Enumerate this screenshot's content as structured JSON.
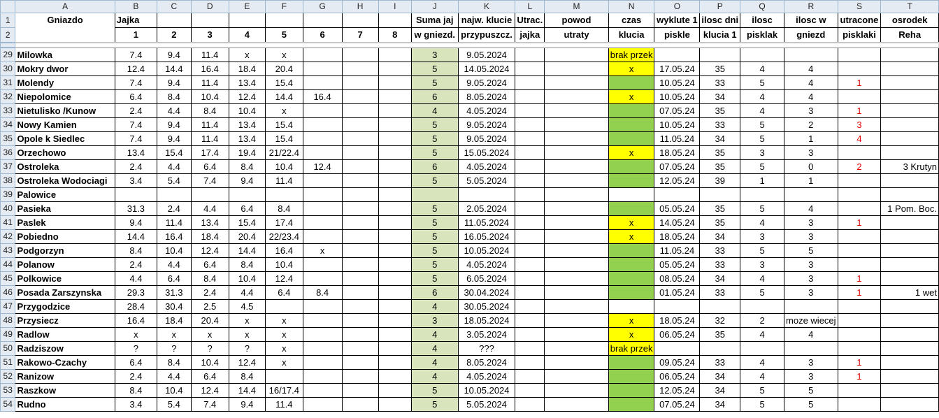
{
  "columns": [
    "A",
    "B",
    "C",
    "D",
    "E",
    "F",
    "G",
    "H",
    "I",
    "J",
    "K",
    "L",
    "M",
    "N",
    "O",
    "P",
    "Q",
    "R",
    "S",
    "T"
  ],
  "header": {
    "row1": {
      "num": "1",
      "A": "Gniazdo",
      "B": "Jajka",
      "J": "Suma jaj",
      "K": "najw. klucie",
      "L": "Utrac.",
      "M": "powod",
      "N": "czas",
      "O": "wyklute 1",
      "P": "ilosc dni",
      "Q": "ilosc",
      "R": "ilosc w",
      "S": "utracone",
      "T": "osrodek"
    },
    "row2": {
      "num": "2",
      "B": "1",
      "C": "2",
      "D": "3",
      "E": "4",
      "F": "5",
      "G": "6",
      "H": "7",
      "I": "8",
      "J": "w gniezd.",
      "K": "przypuszcz.",
      "L": "jajka",
      "M": "utraty",
      "N": "klucia",
      "O": "piskle",
      "P": "klucia 1",
      "Q": "pisklak",
      "R": "gniezd",
      "S": "pisklaki",
      "T": "Reha"
    }
  },
  "rows": [
    {
      "num": "29",
      "name": "Milowka",
      "eggs": [
        "7.4",
        "9.4",
        "11.4",
        "x",
        "x",
        "",
        "",
        ""
      ],
      "total": "3",
      "date": "9.05.2024",
      "lost": "",
      "reason": "",
      "time": "brak przek",
      "hatched": "",
      "days": "",
      "chicks": "",
      "innest": "",
      "lostchicks": "",
      "center": ""
    },
    {
      "num": "30",
      "name": "Mokry dwor",
      "eggs": [
        "12.4",
        "14.4",
        "16.4",
        "18.4",
        "20.4",
        "",
        "",
        ""
      ],
      "total": "5",
      "date": "14.05.2024",
      "lost": "",
      "reason": "",
      "time": "x",
      "hatched": "17.05.24",
      "days": "35",
      "chicks": "4",
      "innest": "4",
      "lostchicks": "",
      "center": ""
    },
    {
      "num": "31",
      "name": "Molendy",
      "eggs": [
        "7.4",
        "9.4",
        "11.4",
        "13.4",
        "15.4",
        "",
        "",
        ""
      ],
      "total": "5",
      "date": "9.05.2024",
      "lost": "",
      "reason": "",
      "time": "",
      "hatched": "10.05.24",
      "days": "33",
      "chicks": "5",
      "innest": "4",
      "lostchicks": "1",
      "center": ""
    },
    {
      "num": "32",
      "name": "Niepolomice",
      "eggs": [
        "6.4",
        "8.4",
        "10.4",
        "12.4",
        "14.4",
        "16.4",
        "",
        ""
      ],
      "total": "6",
      "date": "8.05.2024",
      "lost": "",
      "reason": "",
      "time": "x",
      "hatched": "10.05.24",
      "days": "34",
      "chicks": "4",
      "innest": "4",
      "lostchicks": "",
      "center": ""
    },
    {
      "num": "33",
      "name": "Nietulisko /Kunow",
      "eggs": [
        "2.4",
        "4.4",
        "8.4",
        "10.4",
        "x",
        "",
        "",
        ""
      ],
      "total": "4",
      "date": "4.05.2024",
      "lost": "",
      "reason": "",
      "time": "",
      "hatched": "07.05.24",
      "days": "35",
      "chicks": "4",
      "innest": "3",
      "lostchicks": "1",
      "center": ""
    },
    {
      "num": "34",
      "name": "Nowy Kamien",
      "eggs": [
        "7.4",
        "9.4",
        "11.4",
        "13.4",
        "15.4",
        "",
        "",
        ""
      ],
      "total": "5",
      "date": "9.05.2024",
      "lost": "",
      "reason": "",
      "time": "",
      "hatched": "10.05.24",
      "days": "33",
      "chicks": "5",
      "innest": "2",
      "lostchicks": "3",
      "center": ""
    },
    {
      "num": "35",
      "name": "Opole k Siedlec",
      "eggs": [
        "7.4",
        "9.4",
        "11.4",
        "13.4",
        "15.4",
        "",
        "",
        ""
      ],
      "total": "5",
      "date": "9.05.2024",
      "lost": "",
      "reason": "",
      "time": "",
      "hatched": "11.05.24",
      "days": "34",
      "chicks": "5",
      "innest": "1",
      "lostchicks": "4",
      "center": ""
    },
    {
      "num": "36",
      "name": "Orzechowo",
      "eggs": [
        "13.4",
        "15.4",
        "17.4",
        "19.4",
        "21/22.4",
        "",
        "",
        ""
      ],
      "total": "5",
      "date": "15.05.2024",
      "lost": "",
      "reason": "",
      "time": "x",
      "hatched": "18.05.24",
      "days": "35",
      "chicks": "3",
      "innest": "3",
      "lostchicks": "",
      "center": ""
    },
    {
      "num": "37",
      "name": "Ostroleka",
      "eggs": [
        "2.4",
        "4.4",
        "6.4",
        "8.4",
        "10.4",
        "12.4",
        "",
        ""
      ],
      "total": "6",
      "date": "4.05.2024",
      "lost": "",
      "reason": "",
      "time": "",
      "hatched": "07.05.24",
      "days": "35",
      "chicks": "5",
      "innest": "0",
      "lostchicks": "2",
      "center": "3 Krutyn"
    },
    {
      "num": "38",
      "name": "Ostroleka Wodociagi",
      "eggs": [
        "3.4",
        "5.4",
        "7.4",
        "9.4",
        "11.4",
        "",
        "",
        ""
      ],
      "total": "5",
      "date": "5.05.2024",
      "lost": "",
      "reason": "",
      "time": "",
      "hatched": "12.05.24",
      "days": "39",
      "chicks": "1",
      "innest": "1",
      "lostchicks": "",
      "center": ""
    },
    {
      "num": "39",
      "name": "Palowice",
      "eggs": [
        "",
        "",
        "",
        "",
        "",
        "",
        "",
        ""
      ],
      "total": "",
      "date": "",
      "lost": "",
      "reason": "",
      "time": "",
      "hatched": "",
      "days": "",
      "chicks": "",
      "innest": "",
      "lostchicks": "",
      "center": ""
    },
    {
      "num": "40",
      "name": "Pasieka",
      "eggs": [
        "31.3",
        "2.4",
        "4.4",
        "6.4",
        "8.4",
        "",
        "",
        ""
      ],
      "total": "5",
      "date": "2.05.2024",
      "lost": "",
      "reason": "",
      "time": "",
      "hatched": "05.05.24",
      "days": "35",
      "chicks": "5",
      "innest": "4",
      "lostchicks": "",
      "center": "1 Pom. Boc."
    },
    {
      "num": "41",
      "name": "Paslek",
      "eggs": [
        "9.4",
        "11.4",
        "13.4",
        "15.4",
        "17.4",
        "",
        "",
        ""
      ],
      "total": "5",
      "date": "11.05.2024",
      "lost": "",
      "reason": "",
      "time": "x",
      "hatched": "14.05.24",
      "days": "35",
      "chicks": "4",
      "innest": "3",
      "lostchicks": "1",
      "center": ""
    },
    {
      "num": "42",
      "name": "Pobiedno",
      "eggs": [
        "14.4",
        "16.4",
        "18.4",
        "20.4",
        "22/23.4",
        "",
        "",
        ""
      ],
      "total": "5",
      "date": "16.05.2024",
      "lost": "",
      "reason": "",
      "time": "x",
      "hatched": "18.05.24",
      "days": "34",
      "chicks": "3",
      "innest": "3",
      "lostchicks": "",
      "center": ""
    },
    {
      "num": "43",
      "name": "Podgorzyn",
      "eggs": [
        "8.4",
        "10.4",
        "12.4",
        "14.4",
        "16.4",
        "x",
        "",
        ""
      ],
      "total": "5",
      "date": "10.05.2024",
      "lost": "",
      "reason": "",
      "time": "",
      "hatched": "11.05.24",
      "days": "33",
      "chicks": "5",
      "innest": "5",
      "lostchicks": "",
      "center": ""
    },
    {
      "num": "44",
      "name": "Polanow",
      "eggs": [
        "2.4",
        "4.4",
        "6.4",
        "8.4",
        "10.4",
        "",
        "",
        ""
      ],
      "total": "5",
      "date": "4.05.2024",
      "lost": "",
      "reason": "",
      "time": "",
      "hatched": "05.05.24",
      "days": "33",
      "chicks": "3",
      "innest": "3",
      "lostchicks": "",
      "center": ""
    },
    {
      "num": "45",
      "name": "Polkowice",
      "eggs": [
        "4.4",
        "6.4",
        "8.4",
        "10.4",
        "12.4",
        "",
        "",
        ""
      ],
      "total": "5",
      "date": "6.05.2024",
      "lost": "",
      "reason": "",
      "time": "",
      "hatched": "08.05.24",
      "days": "34",
      "chicks": "4",
      "innest": "3",
      "lostchicks": "1",
      "center": ""
    },
    {
      "num": "46",
      "name": "Posada Zarszynska",
      "eggs": [
        "29.3",
        "31.3",
        "2.4",
        "4.4",
        "6.4",
        "8.4",
        "",
        ""
      ],
      "total": "6",
      "date": "30.04.2024",
      "lost": "",
      "reason": "",
      "time": "",
      "hatched": "01.05.24",
      "days": "33",
      "chicks": "5",
      "innest": "3",
      "lostchicks": "1",
      "center": "1 wet"
    },
    {
      "num": "47",
      "name": "Przygodzice",
      "eggs": [
        "28.4",
        "30.4",
        "2.5",
        "4.5",
        "",
        "",
        "",
        ""
      ],
      "total": "4",
      "date": "30.05.2024",
      "lost": "",
      "reason": "",
      "time": "",
      "hatched": "",
      "days": "",
      "chicks": "",
      "innest": "",
      "lostchicks": "",
      "center": ""
    },
    {
      "num": "48",
      "name": "Przysiecz",
      "eggs": [
        "16.4",
        "18.4",
        "20.4",
        "x",
        "x",
        "",
        "",
        ""
      ],
      "total": "3",
      "date": "18.05.2024",
      "lost": "",
      "reason": "",
      "time": "x",
      "hatched": "18.05.24",
      "days": "32",
      "chicks": "2",
      "innest": "moze wiecej",
      "lostchicks": "",
      "center": ""
    },
    {
      "num": "49",
      "name": "Radlow",
      "eggs": [
        "x",
        "x",
        "x",
        "x",
        "x",
        "",
        "",
        ""
      ],
      "total": "4",
      "date": "3.05.2024",
      "lost": "",
      "reason": "",
      "time": "x",
      "hatched": "06.05.24",
      "days": "35",
      "chicks": "4",
      "innest": "4",
      "lostchicks": "",
      "center": ""
    },
    {
      "num": "50",
      "name": "Radziszow",
      "eggs": [
        "?",
        "?",
        "?",
        "?",
        "x",
        "",
        "",
        ""
      ],
      "total": "4",
      "date": "???",
      "lost": "",
      "reason": "",
      "time": "brak przek",
      "hatched": "",
      "days": "",
      "chicks": "",
      "innest": "",
      "lostchicks": "",
      "center": ""
    },
    {
      "num": "51",
      "name": "Rakowo-Czachy",
      "eggs": [
        "6.4",
        "8.4",
        "10.4",
        "12.4",
        "x",
        "",
        "",
        ""
      ],
      "total": "4",
      "date": "8.05.2024",
      "lost": "",
      "reason": "",
      "time": "",
      "hatched": "09.05.24",
      "days": "33",
      "chicks": "4",
      "innest": "3",
      "lostchicks": "1",
      "center": ""
    },
    {
      "num": "52",
      "name": "Ranizow",
      "eggs": [
        "2.4",
        "4.4",
        "6.4",
        "8.4",
        "",
        "",
        "",
        ""
      ],
      "total": "4",
      "date": "4.05.2024",
      "lost": "",
      "reason": "",
      "time": "",
      "hatched": "06.05.24",
      "days": "34",
      "chicks": "4",
      "innest": "3",
      "lostchicks": "1",
      "center": ""
    },
    {
      "num": "53",
      "name": "Raszkow",
      "eggs": [
        "8.4",
        "10.4",
        "12.4",
        "14.4",
        "16/17.4",
        "",
        "",
        ""
      ],
      "total": "5",
      "date": "10.05.2024",
      "lost": "",
      "reason": "",
      "time": "",
      "hatched": "12.05.24",
      "days": "34",
      "chicks": "5",
      "innest": "5",
      "lostchicks": "",
      "center": ""
    },
    {
      "num": "54",
      "name": "Rudno",
      "eggs": [
        "3.4",
        "5.4",
        "7.4",
        "9.4",
        "11.4",
        "",
        "",
        ""
      ],
      "total": "5",
      "date": "5.05.2024",
      "lost": "",
      "reason": "",
      "time": "",
      "hatched": "07.05.24",
      "days": "34",
      "chicks": "5",
      "innest": "5",
      "lostchicks": "",
      "center": ""
    }
  ],
  "time_cell_colors": {
    "29": "#ffff00",
    "30": "#ffff00",
    "31": "#92d050",
    "32": "#ffff00",
    "33": "#92d050",
    "34": "#92d050",
    "35": "#92d050",
    "36": "#ffff00",
    "37": "#92d050",
    "38": "#92d050",
    "39": "",
    "40": "#92d050",
    "41": "#ffff00",
    "42": "#ffff00",
    "43": "#92d050",
    "44": "#92d050",
    "45": "#92d050",
    "46": "#92d050",
    "47": "",
    "48": "#ffff00",
    "49": "#ffff00",
    "50": "#ffff00",
    "51": "#92d050",
    "52": "#92d050",
    "53": "#92d050",
    "54": "#92d050"
  },
  "colors": {
    "total_fill": "#d8e4bc",
    "lost_chicks_text": "#e00000",
    "header_bg": "#e5ebf2"
  }
}
